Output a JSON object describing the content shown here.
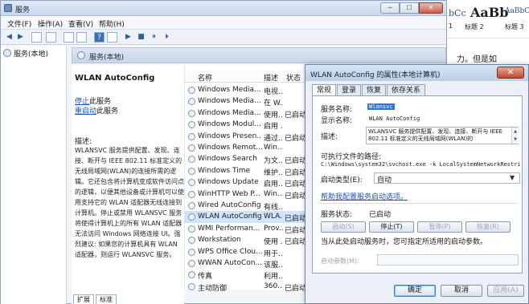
{
  "services_window": {
    "title": "服务",
    "controls": {
      "minimize": "─",
      "maximize": "☐",
      "close": "✕"
    },
    "menu": [
      "文件(F)",
      "操作(A)",
      "查看(V)",
      "帮助(H)"
    ],
    "toolbar": {
      "back": "◀",
      "forward": "▶",
      "help": "?",
      "play": "▶",
      "stop": "■",
      "pause": "⏸",
      "restart": "⏵"
    },
    "tree_item": "服务(本地)",
    "content_header": "服务(本地)"
  },
  "description": {
    "service_name": "WLAN AutoConfig",
    "stop_link": "停止",
    "stop_suffix": "此服务",
    "restart_link": "重启动",
    "restart_suffix": "此服务",
    "heading": "描述:",
    "body": "WLANSVC 服务提供配置、发现、连接、断开与 IEEE 802.11 标准定义的无线局域网(WLAN)的连接所需的逻辑。它还包含将计算机变成软件访问点的逻辑，以便其他设备或计算机可以使用支持它的 WLAN 适配器无线连接到计算机。停止或禁用 WLANSVC 服务将使得计算机上的所有 WLAN 适配器无法访问 Windows 网络连接 UI。强烈建议: 如果您的计算机具有 WLAN 适配器，则运行 WLANSVC 服务。"
  },
  "service_list": {
    "headers": {
      "name": "名称",
      "desc": "描述",
      "status": "状态"
    },
    "rows": [
      {
        "name": "Windows Media...",
        "desc": "电视...",
        "status": ""
      },
      {
        "name": "Windows Media...",
        "desc": "在 W...",
        "status": ""
      },
      {
        "name": "Windows Media...",
        "desc": "使用...",
        "status": "已启动"
      },
      {
        "name": "Windows Modul...",
        "desc": "启用 ...",
        "status": ""
      },
      {
        "name": "Windows Presen...",
        "desc": "通过...",
        "status": "已启动"
      },
      {
        "name": "Windows Remot...",
        "desc": "Win...",
        "status": ""
      },
      {
        "name": "Windows Search",
        "desc": "为文...",
        "status": "已启动"
      },
      {
        "name": "Windows Time",
        "desc": "维护...",
        "status": "已启动"
      },
      {
        "name": "Windows Update",
        "desc": "启用...",
        "status": "已启动"
      },
      {
        "name": "WinHTTP Web P...",
        "desc": "Win...",
        "status": "已启动"
      },
      {
        "name": "Wired AutoConfig",
        "desc": "有线...",
        "status": ""
      },
      {
        "name": "WLAN AutoConfig",
        "desc": "WLA...",
        "status": "已启动"
      },
      {
        "name": "WMI Performan...",
        "desc": "Prov...",
        "status": "已启动"
      },
      {
        "name": "Workstation",
        "desc": "使用 ...",
        "status": "已启动"
      },
      {
        "name": "WPS Office Clou...",
        "desc": "用于...",
        "status": ""
      },
      {
        "name": "WWAN AutoCon...",
        "desc": "该服...",
        "status": ""
      },
      {
        "name": "传真",
        "desc": "利用...",
        "status": ""
      },
      {
        "name": "主动防御",
        "desc": "360...",
        "status": "已启动"
      }
    ]
  },
  "bottom_tabs": {
    "extended": "扩展",
    "standard": "标准"
  },
  "word_background": {
    "style1_sample": "bCc",
    "style2_sample": "AaBb",
    "style3_sample": "AaBbCcD",
    "style1_name": "1",
    "style2_name": "标题 2",
    "style3_name": "标题 3",
    "doc_text": "力。但是如"
  },
  "dialog": {
    "title": "WLAN AutoConfig 的属性(本地计算机)",
    "close": "✕",
    "tabs": [
      "常规",
      "登录",
      "恢复",
      "依存关系"
    ],
    "labels": {
      "service_name": "服务名称:",
      "display_name": "显示名称:",
      "description": "描述:",
      "path": "可执行文件的路径:",
      "startup_type": "启动类型(E):",
      "help_link": "帮助我配置服务启动选项。",
      "service_status": "服务状态:",
      "hint": "当从此处启动服务时，您可指定所适用的启动参数。",
      "start_params": "启动参数(M):"
    },
    "values": {
      "service_name": "Wlansvc",
      "display_name": "WLAN AutoConfig",
      "description": "WLANSVC 服务提供配置、发现、连接、断开与 IEEE 802.11 标准定义的无线局域网(WLAN)的",
      "path": "C:\\Windows\\system32\\svchost.exe -k LocalSystemNetworkRestricted",
      "startup_type": "自动",
      "service_status": "已启动"
    },
    "service_buttons": {
      "start": "启动(S)",
      "stop": "停止(T)",
      "pause": "暂停(P)",
      "resume": "恢复(R)"
    },
    "buttons": {
      "ok": "确定",
      "cancel": "取消",
      "apply": "应用(A)"
    }
  }
}
